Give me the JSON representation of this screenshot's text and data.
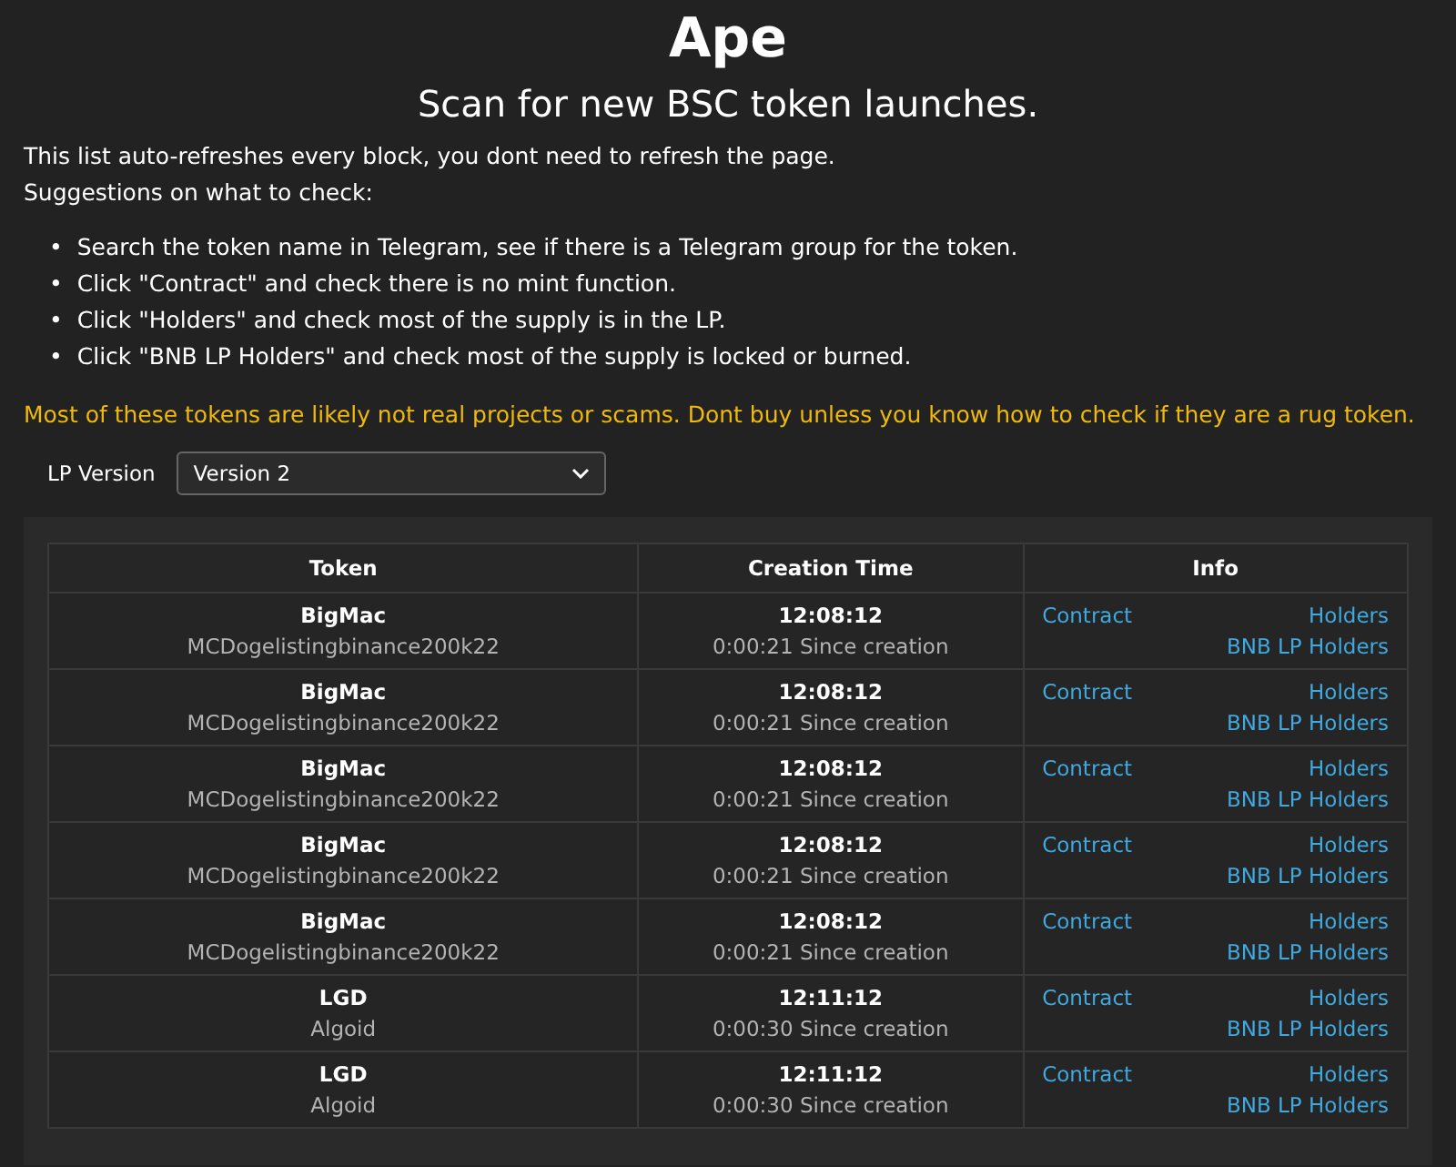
{
  "title": "Ape",
  "subtitle": "Scan for new BSC token launches.",
  "intro": [
    "This list auto-refreshes every block, you dont need to refresh the page.",
    "Suggestions on what to check:"
  ],
  "suggestions": [
    {
      "bullet": "•",
      "text": "Search the token name in Telegram, see if there is a Telegram group for the token."
    },
    {
      "bullet": "•",
      "text": "Click \"Contract\" and check there is no mint function."
    },
    {
      "bullet": "•",
      "text": "Click \"Holders\" and check most of the supply is in the LP."
    },
    {
      "bullet": "•",
      "text": "Click \"BNB LP Holders\" and check most of the supply is locked or burned."
    }
  ],
  "warning": "Most of these tokens are likely not real projects or scams. Dont buy unless you know how to check if they are a rug token.",
  "lp_version": {
    "label": "LP Version",
    "value": "Version 2"
  },
  "table": {
    "columns": [
      "Token",
      "Creation Time",
      "Info"
    ],
    "rows": [
      {
        "symbol": "BigMac",
        "name": "MCDogelistingbinance200k22",
        "time": "12:08:12",
        "age": "0:00:21 Since creation",
        "contract": "Contract",
        "holders": "Holders",
        "lp_holders": "BNB LP Holders"
      },
      {
        "symbol": "BigMac",
        "name": "MCDogelistingbinance200k22",
        "time": "12:08:12",
        "age": "0:00:21 Since creation",
        "contract": "Contract",
        "holders": "Holders",
        "lp_holders": "BNB LP Holders"
      },
      {
        "symbol": "BigMac",
        "name": "MCDogelistingbinance200k22",
        "time": "12:08:12",
        "age": "0:00:21 Since creation",
        "contract": "Contract",
        "holders": "Holders",
        "lp_holders": "BNB LP Holders"
      },
      {
        "symbol": "BigMac",
        "name": "MCDogelistingbinance200k22",
        "time": "12:08:12",
        "age": "0:00:21 Since creation",
        "contract": "Contract",
        "holders": "Holders",
        "lp_holders": "BNB LP Holders"
      },
      {
        "symbol": "BigMac",
        "name": "MCDogelistingbinance200k22",
        "time": "12:08:12",
        "age": "0:00:21 Since creation",
        "contract": "Contract",
        "holders": "Holders",
        "lp_holders": "BNB LP Holders"
      },
      {
        "symbol": "LGD",
        "name": "Algoid",
        "time": "12:11:12",
        "age": "0:00:30 Since creation",
        "contract": "Contract",
        "holders": "Holders",
        "lp_holders": "BNB LP Holders"
      },
      {
        "symbol": "LGD",
        "name": "Algoid",
        "time": "12:11:12",
        "age": "0:00:30 Since creation",
        "contract": "Contract",
        "holders": "Holders",
        "lp_holders": "BNB LP Holders"
      }
    ]
  }
}
